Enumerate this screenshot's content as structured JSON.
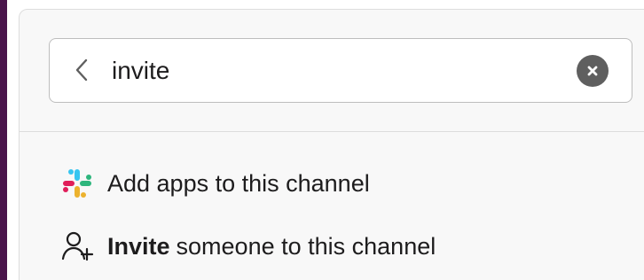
{
  "sidebar": {
    "accent_color": "#4a154b"
  },
  "search": {
    "value": "invite",
    "back_icon": "chevron-left-icon",
    "clear_icon": "close-icon"
  },
  "results": [
    {
      "label": "Add apps to this channel",
      "icon": "slack-logo-icon"
    },
    {
      "highlighted": "Invite",
      "label": "someone to this channel",
      "icon": "add-user-icon"
    }
  ],
  "colors": {
    "popover_background": "#f8f8f8",
    "border": "#dddddd",
    "text": "#1d1c1d",
    "clear_button": "#5f5f5f",
    "slack_blue": "#36c5f0",
    "slack_green": "#2eb67d",
    "slack_yellow": "#ecb22e",
    "slack_red": "#e01e5a"
  }
}
